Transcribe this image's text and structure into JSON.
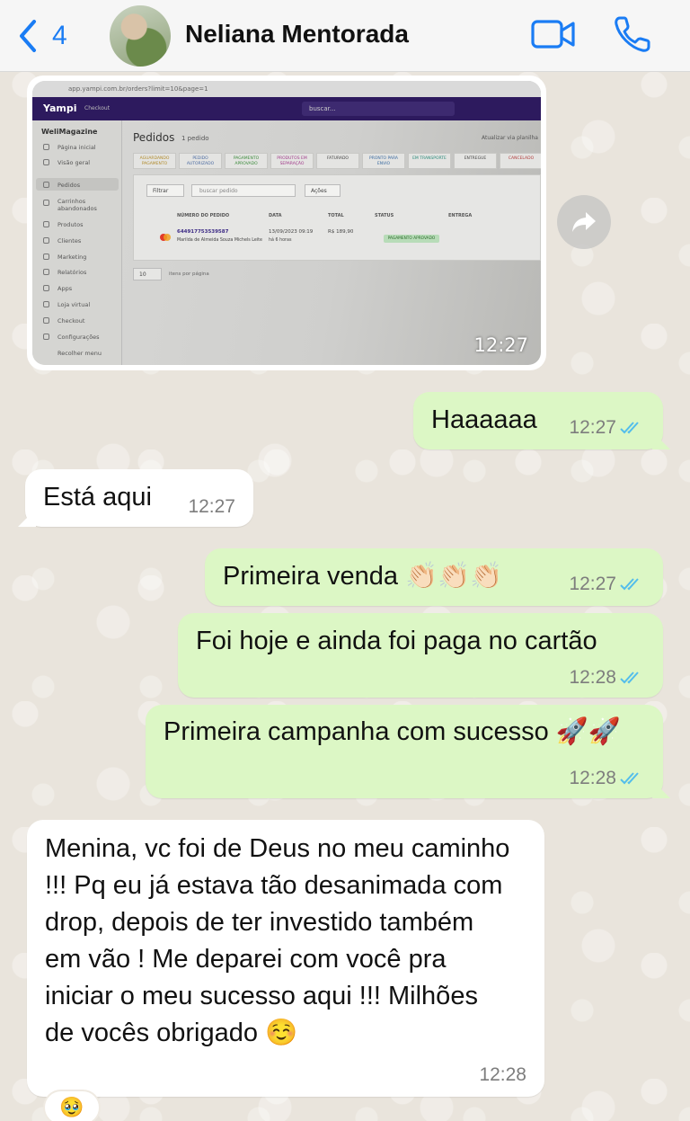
{
  "header": {
    "back_count": "4",
    "contact_name": "Neliana Mentorada"
  },
  "image_message": {
    "time": "12:27",
    "screenshot": {
      "url": "app.yampi.com.br/orders?limit=10&page=1",
      "brand": "Yampi",
      "brand_sub": "Checkout",
      "search_placeholder": "buscar...",
      "store_name": "WeliMagazine",
      "sidebar": [
        "Página inicial",
        "Visão geral",
        "Pedidos",
        "Carrinhos abandonados",
        "Produtos",
        "Clientes",
        "Marketing",
        "Relatórios",
        "Apps",
        "Loja virtual",
        "Checkout",
        "Configurações",
        "Recolher menu"
      ],
      "title": "Pedidos",
      "count": "1 pedido",
      "update_label": "Atualizar via planilha",
      "status_tabs": [
        "AGUARDANDO PAGAMENTO",
        "PEDIDO AUTORIZADO",
        "PAGAMENTO APROVADO",
        "PRODUTOS EM SEPARAÇÃO",
        "FATURADO",
        "PRONTO PARA ENVIO",
        "EM TRANSPORTE",
        "ENTREGUE",
        "CANCELADO"
      ],
      "filter_label": "Filtrar",
      "search_order_placeholder": "buscar pedido",
      "actions_label": "Ações",
      "columns": [
        "NÚMERO DO PEDIDO",
        "DATA",
        "TOTAL",
        "STATUS",
        "ENTREGA"
      ],
      "order": {
        "number": "644917753539587",
        "customer": "Marilda de Almeida Souza Michels Leite",
        "date": "13/09/2023 09:19",
        "ago": "há 6 horas",
        "total": "R$ 189,90",
        "status": "PAGAMENTO APROVADO"
      },
      "per_page": "10",
      "per_page_label": "itens por página"
    }
  },
  "messages": [
    {
      "dir": "out",
      "text": "Haaaaaa",
      "time": "12:27"
    },
    {
      "dir": "in",
      "text": "Está aqui",
      "time": "12:27"
    },
    {
      "dir": "out",
      "text": "Primeira venda 👏🏻👏🏻👏🏻",
      "time": "12:27"
    },
    {
      "dir": "out",
      "text": "Foi hoje e ainda foi paga no cartão",
      "time": "12:28"
    },
    {
      "dir": "out",
      "text": "Primeira campanha com sucesso 🚀🚀",
      "time": "12:28"
    },
    {
      "dir": "in",
      "text": "Menina, vc foi de Deus no meu caminho !!! Pq eu já estava tão desanimada com drop, depois de ter investido também em vão ! Me deparei com você pra iniciar o meu sucesso aqui !!! Milhões de vocês obrigado ☺️",
      "time": "12:28"
    }
  ],
  "reaction": "🥹",
  "colors": {
    "accent": "#1a7cf4",
    "outgoing_bubble": "#dcf7c5",
    "incoming_bubble": "#ffffff",
    "read_ticks": "#53bdeb"
  }
}
